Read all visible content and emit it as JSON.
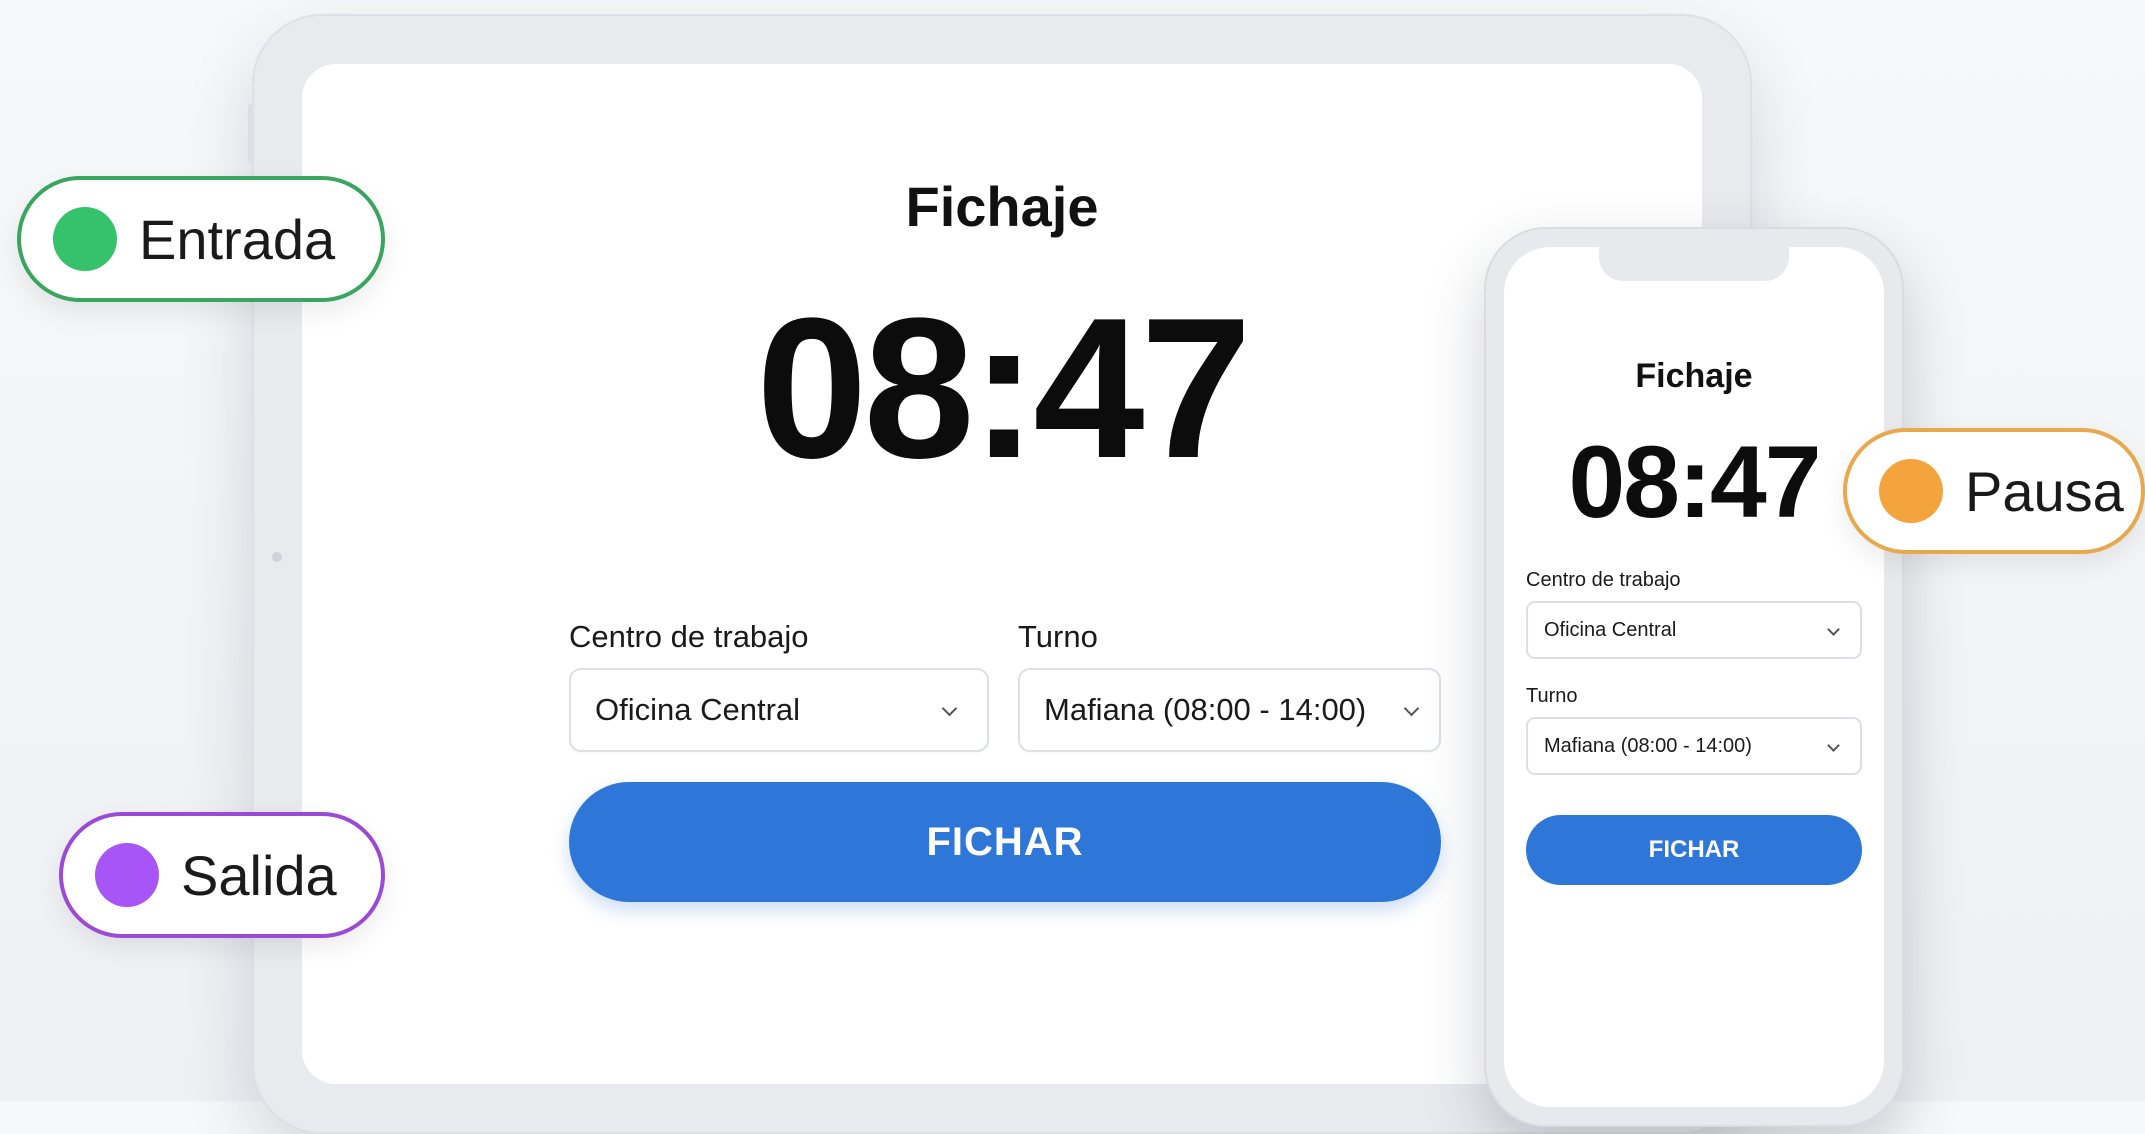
{
  "tablet": {
    "title": "Fichaje",
    "time": "08:47",
    "work_center": {
      "label": "Centro de trabajo",
      "value": "Oficina Central"
    },
    "shift": {
      "label": "Turno",
      "value": "Mafiana (08:00 - 14:00)"
    },
    "button": "FICHAR"
  },
  "phone": {
    "title": "Fichaje",
    "time": "08:47",
    "work_center": {
      "label": "Centro de trabajo",
      "value": "Oficina Central"
    },
    "shift": {
      "label": "Turno",
      "value": "Mafiana (08:00 - 14:00)"
    },
    "button": "FICHAR"
  },
  "statuses": {
    "entrada": {
      "label": "Entrada",
      "color": "#34c26a"
    },
    "salida": {
      "label": "Salida",
      "color": "#a855f7"
    },
    "pausa": {
      "label": "Pausa",
      "color": "#f3a43c"
    }
  },
  "colors": {
    "accent": "#2e77d8"
  }
}
